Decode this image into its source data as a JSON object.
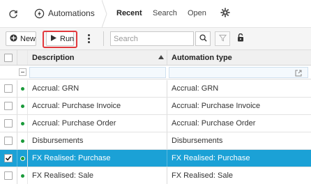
{
  "topbar": {
    "app_title": "Automations",
    "refresh_icon": "refresh-icon",
    "app_icon": "automation-icon",
    "settings_icon": "gear-icon",
    "tabs": [
      {
        "label": "Recent",
        "active": true
      },
      {
        "label": "Search",
        "active": false
      },
      {
        "label": "Open",
        "active": false
      }
    ]
  },
  "toolbar": {
    "new_label": "New",
    "run_label": "Run",
    "search_placeholder": "Search",
    "search_value": "",
    "highlight_color": "#e2393d"
  },
  "grid": {
    "columns": [
      "Description",
      "Automation type"
    ],
    "sort_column": "Description",
    "sort_direction": "ascending",
    "status_color": "#1a9a3a",
    "selected_color": "#1ba1d6",
    "rows": [
      {
        "description": "Accrual: GRN",
        "type": "Accrual: GRN",
        "selected": false
      },
      {
        "description": "Accrual: Purchase Invoice",
        "type": "Accrual: Purchase Invoice",
        "selected": false
      },
      {
        "description": "Accrual: Purchase Order",
        "type": "Accrual: Purchase Order",
        "selected": false
      },
      {
        "description": "Disbursements",
        "type": "Disbursements",
        "selected": false
      },
      {
        "description": "FX Realised: Purchase",
        "type": "FX Realised: Purchase",
        "selected": true
      },
      {
        "description": "FX Realised: Sale",
        "type": "FX Realised: Sale",
        "selected": false
      }
    ]
  }
}
